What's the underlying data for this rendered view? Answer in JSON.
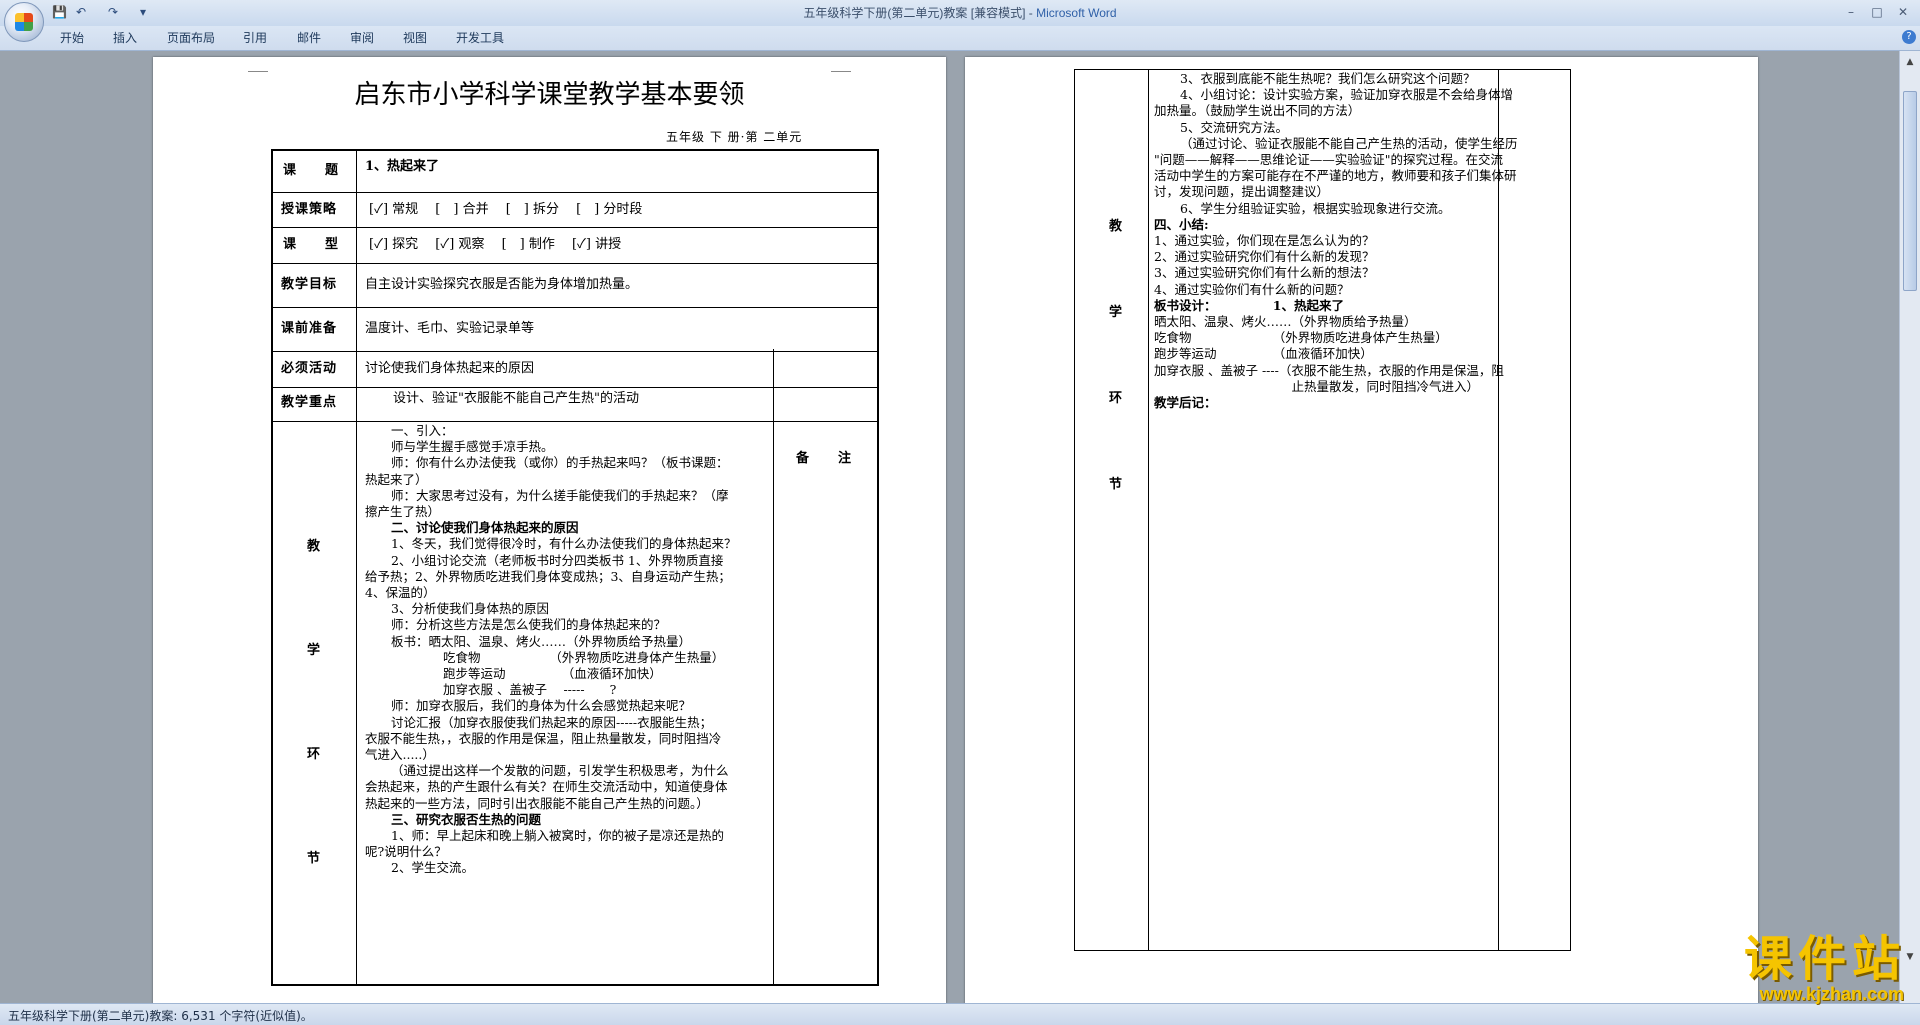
{
  "window": {
    "title_doc": "五年级科学下册(第二单元)教案 [兼容模式] - ",
    "title_app": "Microsoft Word",
    "min": "–",
    "max": "□",
    "close": "✕"
  },
  "qat": {
    "save": "💾",
    "undo": "↶",
    "redo": "↷",
    "more": "▾"
  },
  "tabs": [
    "开始",
    "插入",
    "页面布局",
    "引用",
    "邮件",
    "审阅",
    "视图",
    "开发工具"
  ],
  "help": "?",
  "page1": {
    "title": "启东市小学科学课堂教学基本要领",
    "subtitle": "五年级 下 册·第 二单元",
    "rows": [
      {
        "label": "课　　题",
        "value": "1、热起来了"
      },
      {
        "label": "授课策略",
        "value": "[✓] 常规　 [　] 合并　 [　] 拆分　 [　] 分时段"
      },
      {
        "label": "课　　型",
        "value": "[✓] 探究　 [✓] 观察　 [　] 制作　 [✓] 讲授"
      },
      {
        "label": "教学目标",
        "value": "自主设计实验探究衣服是否能为身体增加热量。"
      },
      {
        "label": "课前准备",
        "value": "温度计、毛巾、实验记录单等"
      },
      {
        "label": "必须活动",
        "value": "讨论使我们身体热起来的原因"
      },
      {
        "label": "教学重点",
        "value": "设计、验证\"衣服能不能自己产生热\"的活动"
      }
    ],
    "side_chars": [
      "教",
      "学",
      "环",
      "节"
    ],
    "note_header": "备　　注",
    "body": [
      {
        "t": "一、引入：",
        "indent": 1
      },
      {
        "t": "师与学生握手感觉手凉手热。",
        "indent": 1
      },
      {
        "t": "师：你有什么办法使我（或你）的手热起来吗？（板书课题：",
        "indent": 1
      },
      {
        "t": "热起来了）",
        "indent": 0
      },
      {
        "t": "师：大家思考过没有，为什么搓手能使我们的手热起来？（摩",
        "indent": 1
      },
      {
        "t": "擦产生了热）",
        "indent": 0
      },
      {
        "t": "二、讨论使我们身体热起来的原因",
        "indent": 1,
        "bold": true
      },
      {
        "t": "1、冬天，我们觉得很冷时，有什么办法使我们的身体热起来？",
        "indent": 1
      },
      {
        "t": "2、小组讨论交流（老师板书时分四类板书 1、外界物质直接",
        "indent": 1
      },
      {
        "t": "给予热；2、外界物质吃进我们身体变成热；3、自身运动产生热；",
        "indent": 0
      },
      {
        "t": "4、保温的）",
        "indent": 0
      },
      {
        "t": "3、分析使我们身体热的原因",
        "indent": 1
      },
      {
        "t": "师：分析这些方法是怎么使我们的身体热起来的？",
        "indent": 1
      },
      {
        "t": "板书：晒太阳、温泉、烤火……（外界物质给予热量）",
        "indent": 1,
        "boldPrefix": "板书："
      },
      {
        "t": "吃食物　　　　　　（外界物质吃进身体产生热量）",
        "indent": 3
      },
      {
        "t": "跑步等运动　　　　　（血液循环加快）",
        "indent": 3
      },
      {
        "t": "加穿衣服 、盖被子　 -----　　?",
        "indent": 3
      },
      {
        "t": "师：加穿衣服后，我们的身体为什么会感觉热起来呢？",
        "indent": 1
      },
      {
        "t": "讨论汇报（加穿衣服使我们热起来的原因-----衣服能生热；",
        "indent": 1
      },
      {
        "t": "衣服不能生热，，衣服的作用是保温，阻止热量散发，同时阻挡冷",
        "indent": 0
      },
      {
        "t": "气进入.....）",
        "indent": 0
      },
      {
        "t": "（通过提出这样一个发散的问题，引发学生积极思考，为什么",
        "indent": 1
      },
      {
        "t": "会热起来，热的产生跟什么有关？在师生交流活动中，知道使身体",
        "indent": 0
      },
      {
        "t": "热起来的一些方法，同时引出衣服能不能自己产生热的问题。）",
        "indent": 0
      },
      {
        "t": "三、研究衣服否生热的问题",
        "indent": 1,
        "bold": true
      },
      {
        "t": "1、师：早上起床和晚上躺入被窝时，你的被子是凉还是热的",
        "indent": 1
      },
      {
        "t": "呢?说明什么？",
        "indent": 0
      },
      {
        "t": "2、学生交流。",
        "indent": 1
      }
    ]
  },
  "page2": {
    "side_chars": [
      "教",
      "学",
      "环",
      "节"
    ],
    "body": [
      {
        "t": "3、衣服到底能不能生热呢？我们怎么研究这个问题？",
        "indent": 1
      },
      {
        "t": "4、小组讨论：设计实验方案，验证加穿衣服是不会给身体增",
        "indent": 1
      },
      {
        "t": "加热量。（鼓励学生说出不同的方法）",
        "indent": 0
      },
      {
        "t": "5、交流研究方法。",
        "indent": 1
      },
      {
        "t": "（通过讨论、验证衣服能不能自己产生热的活动，使学生经历",
        "indent": 1
      },
      {
        "t": "\"问题——解释——思维论证——实验验证\"的探究过程。在交流",
        "indent": 0
      },
      {
        "t": "活动中学生的方案可能存在不严谨的地方，教师要和孩子们集体研",
        "indent": 0
      },
      {
        "t": "讨，发现问题，提出调整建议）",
        "indent": 0
      },
      {
        "t": "6、学生分组验证实验，根据实验现象进行交流。",
        "indent": 1
      },
      {
        "t": "四、小结:",
        "indent": 0,
        "bold": true
      },
      {
        "t": "1、通过实验，你们现在是怎么认为的？",
        "indent": 0
      },
      {
        "t": "2、通过实验研究你们有什么新的发现？",
        "indent": 0
      },
      {
        "t": "3、通过实验研究你们有什么新的想法？",
        "indent": 0
      },
      {
        "t": "4、通过实验你们有什么新的问题？",
        "indent": 0
      },
      {
        "t": "板书设计：　　　　　1、热起来了",
        "indent": 0,
        "bold": true
      },
      {
        "t": "晒太阳、温泉、烤火……（外界物质给予热量）",
        "indent": 0
      },
      {
        "t": "吃食物　　　　　　　（外界物质吃进身体产生热量）",
        "indent": 0
      },
      {
        "t": "跑步等运动　　　　　（血液循环加快）",
        "indent": 0
      },
      {
        "t": "加穿衣服 、盖被子 ----（衣服不能生热，衣服的作用是保温，阻",
        "indent": 0
      },
      {
        "t": "　　　　　　　　　　　止热量散发，同时阻挡冷气进入）",
        "indent": 0
      },
      {
        "t": "教学后记：",
        "indent": 0,
        "bold": true,
        "small": true
      }
    ]
  },
  "status": {
    "text": "五年级科学下册(第二单元)教案: 6,531 个字符(近似值)。"
  },
  "watermark": {
    "cn": "课件站",
    "url": "www.kjzhan.com"
  },
  "colors": {
    "ribbon": "#cfdcee",
    "workspace": "#9aa3ad",
    "watermark": "#f5c400",
    "app_title": "#3061a8"
  }
}
